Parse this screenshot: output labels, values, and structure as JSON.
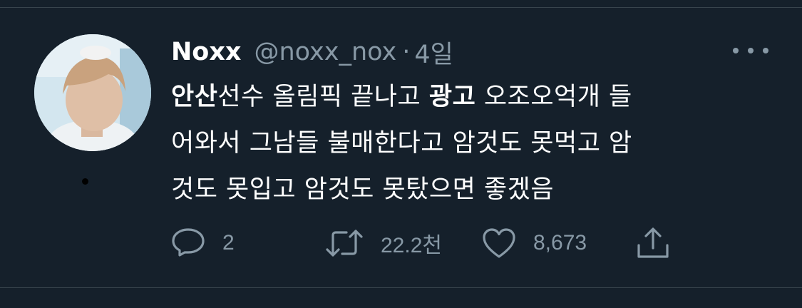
{
  "tweet": {
    "author_name": "Noxx",
    "handle": "@noxx_nox",
    "separator": "·",
    "time": "4일",
    "text": {
      "line1": {
        "bold1": "안산",
        "seg1": "선수 올림픽 끝나고 ",
        "bold2": "광고",
        "seg2": " 오조오억개 들"
      },
      "line2": "어와서 그남들 불매한다고 암것도 못먹고 암",
      "line3": "것도 못입고 암것도 못탔으면 좋겠음"
    }
  },
  "actions": {
    "reply_count": "2",
    "retweet_count": "22.2천",
    "like_count": "8,673"
  },
  "icons": {
    "reply": "reply-icon",
    "retweet": "retweet-icon",
    "like": "heart-icon",
    "share": "share-icon",
    "more": "more-icon"
  },
  "colors": {
    "background": "#15202b",
    "text": "#ffffff",
    "secondary": "#8899a6",
    "divider": "#38444d"
  }
}
